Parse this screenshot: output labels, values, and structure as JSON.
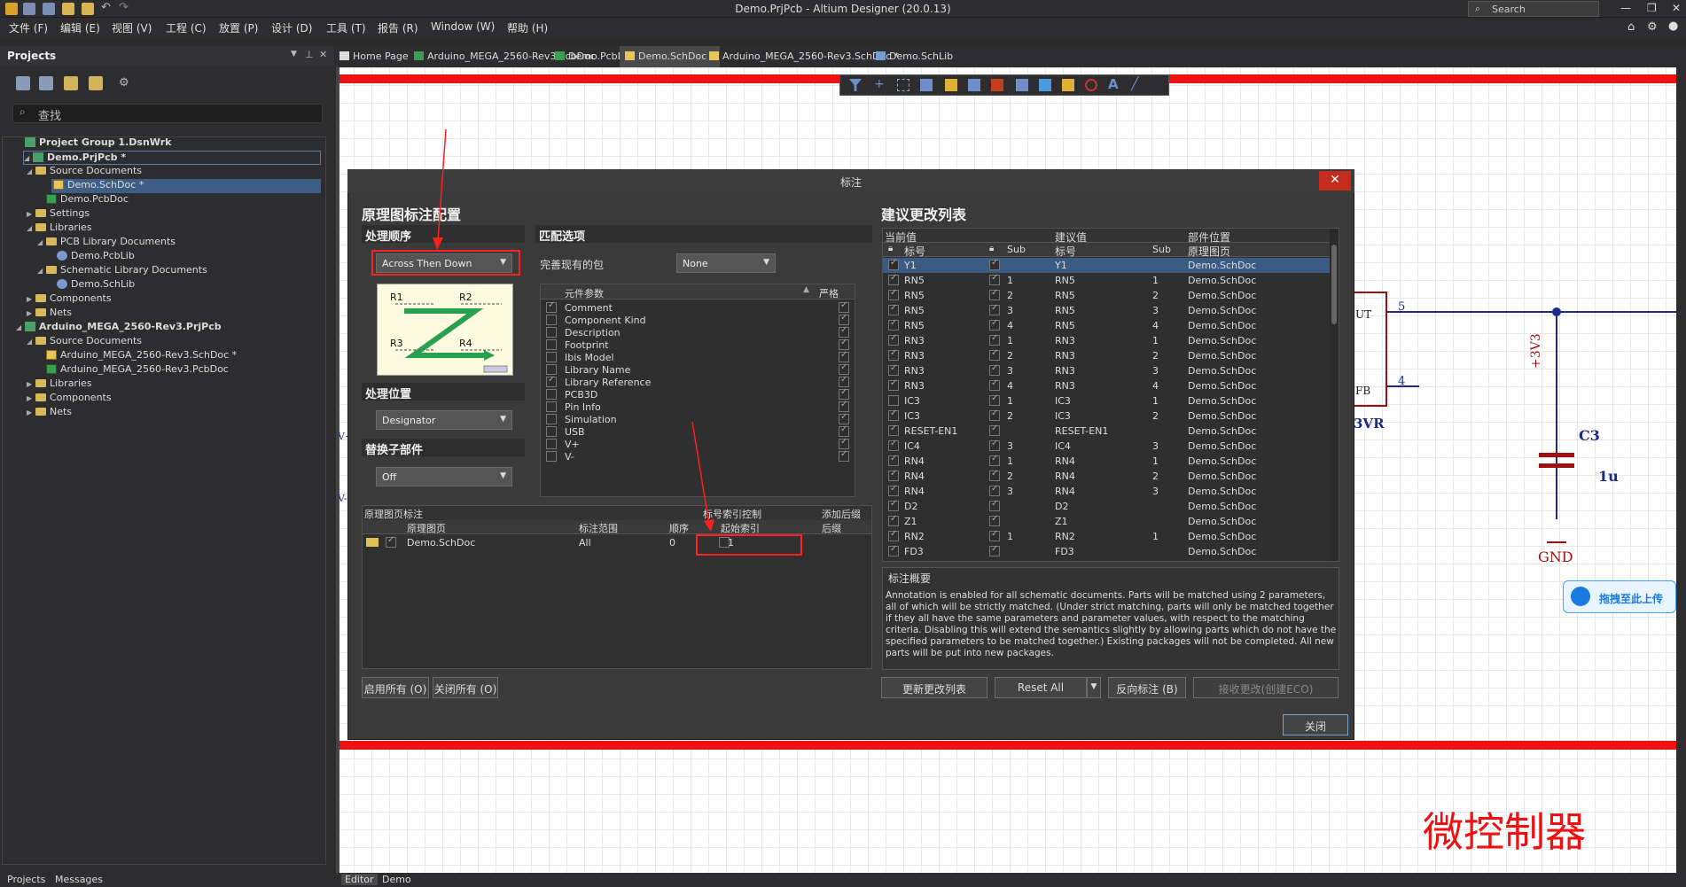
{
  "app": {
    "title": "Demo.PrjPcb - Altium Designer (20.0.13)",
    "search_placeholder": "Search"
  },
  "menu": [
    "文件 (F)",
    "编辑 (E)",
    "视图 (V)",
    "工程 (C)",
    "放置 (P)",
    "设计 (D)",
    "工具 (T)",
    "报告 (R)",
    "Window (W)",
    "帮助 (H)"
  ],
  "projects_panel": {
    "title": "Projects",
    "search_placeholder": "查找",
    "tree": [
      {
        "label": "Project Group 1.DsnWrk",
        "icon": "workspace",
        "depth": 0,
        "expand": ""
      },
      {
        "label": "Demo.PrjPcb *",
        "icon": "project",
        "depth": 0,
        "expand": "open",
        "selected_outline": true
      },
      {
        "label": "Source Documents",
        "icon": "folder",
        "depth": 1,
        "expand": "open"
      },
      {
        "label": "Demo.SchDoc *",
        "icon": "sch",
        "depth": 2,
        "expand": "",
        "selected": true
      },
      {
        "label": "Demo.PcbDoc",
        "icon": "pcb",
        "depth": 2,
        "expand": ""
      },
      {
        "label": "Settings",
        "icon": "folder",
        "depth": 1,
        "expand": "closed"
      },
      {
        "label": "Libraries",
        "icon": "folder",
        "depth": 1,
        "expand": "open"
      },
      {
        "label": "PCB Library Documents",
        "icon": "folder",
        "depth": 2,
        "expand": "open"
      },
      {
        "label": "Demo.PcbLib",
        "icon": "lib",
        "depth": 3,
        "expand": ""
      },
      {
        "label": "Schematic Library Documents",
        "icon": "folder",
        "depth": 2,
        "expand": "open"
      },
      {
        "label": "Demo.SchLib",
        "icon": "lib",
        "depth": 3,
        "expand": ""
      },
      {
        "label": "Components",
        "icon": "folder",
        "depth": 1,
        "expand": "closed"
      },
      {
        "label": "Nets",
        "icon": "folder",
        "depth": 1,
        "expand": "closed"
      },
      {
        "label": "Arduino_MEGA_2560-Rev3.PrjPcb",
        "icon": "project",
        "depth": 0,
        "expand": "open"
      },
      {
        "label": "Source Documents",
        "icon": "folder",
        "depth": 1,
        "expand": "open"
      },
      {
        "label": "Arduino_MEGA_2560-Rev3.SchDoc *",
        "icon": "sch",
        "depth": 2,
        "expand": ""
      },
      {
        "label": "Arduino_MEGA_2560-Rev3.PcbDoc",
        "icon": "pcb",
        "depth": 2,
        "expand": ""
      },
      {
        "label": "Libraries",
        "icon": "folder",
        "depth": 1,
        "expand": "closed"
      },
      {
        "label": "Components",
        "icon": "folder",
        "depth": 1,
        "expand": "closed"
      },
      {
        "label": "Nets",
        "icon": "folder",
        "depth": 1,
        "expand": "closed"
      }
    ],
    "bottom_tabs": [
      "Projects",
      "Messages"
    ]
  },
  "doc_tabs": [
    {
      "label": "Home Page",
      "icon": "home"
    },
    {
      "label": "Arduino_MEGA_2560-Rev3.PcbDoc",
      "icon": "pcb"
    },
    {
      "label": "Demo.PcbDoc",
      "icon": "pcb"
    },
    {
      "label": "Demo.SchDoc *",
      "icon": "sch",
      "active": true
    },
    {
      "label": "Arduino_MEGA_2560-Rev3.SchDoc *",
      "icon": "sch"
    },
    {
      "label": "Demo.SchLib",
      "icon": "lib"
    }
  ],
  "editor_tabs": [
    "Editor",
    "Demo"
  ],
  "dialog": {
    "title": "标注",
    "config_title": "原理图标注配置",
    "order_section": "处理顺序",
    "order_value": "Across Then Down",
    "matching_section": "匹配选项",
    "complete_packages_label": "完善现有的包",
    "complete_packages_value": "None",
    "param_header": "元件参数",
    "strict_header": "严格",
    "params": [
      {
        "name": "Comment",
        "checked": true
      },
      {
        "name": "Component Kind",
        "checked": false
      },
      {
        "name": "Description",
        "checked": false
      },
      {
        "name": "Footprint",
        "checked": false
      },
      {
        "name": "Ibis Model",
        "checked": false
      },
      {
        "name": "Library Name",
        "checked": false
      },
      {
        "name": "Library Reference",
        "checked": true
      },
      {
        "name": "PCB3D",
        "checked": false
      },
      {
        "name": "Pin Info",
        "checked": false
      },
      {
        "name": "Simulation",
        "checked": false
      },
      {
        "name": "USB",
        "checked": false
      },
      {
        "name": "V+",
        "checked": false
      },
      {
        "name": "V-",
        "checked": false
      }
    ],
    "location_section": "处理位置",
    "location_value": "Designator",
    "replace_section": "替换子部件",
    "replace_value": "Off",
    "sheet_section": "原理图页标注",
    "index_control": "标号索引控制",
    "add_suffix": "添加后缀",
    "sheet_cols": [
      "原理图页",
      "标注范围",
      "顺序",
      "起始索引",
      "后缀"
    ],
    "sheet_rows": [
      {
        "sheet": "Demo.SchDoc",
        "scope": "All",
        "order": "0",
        "start_index": "1",
        "suffix": ""
      }
    ],
    "enable_all": "启用所有 (O)",
    "disable_all": "关闭所有 (O)",
    "changes_title": "建议更改列表",
    "current_group": "当前值",
    "proposed_group": "建议值",
    "location_group": "部件位置",
    "col_designator": "标号",
    "col_sub": "Sub",
    "col_new_designator": "标号",
    "col_new_sub": "Sub",
    "col_sheet": "原理图页",
    "changes": [
      {
        "cur": "Y1",
        "cur_sub": "",
        "new": "Y1",
        "new_sub": "",
        "sheet": "Demo.SchDoc",
        "lock1": true,
        "lock2": true,
        "selected": true
      },
      {
        "cur": "RN5",
        "cur_sub": "1",
        "new": "RN5",
        "new_sub": "1",
        "sheet": "Demo.SchDoc",
        "lock1": true,
        "lock2": true
      },
      {
        "cur": "RN5",
        "cur_sub": "2",
        "new": "RN5",
        "new_sub": "2",
        "sheet": "Demo.SchDoc",
        "lock1": true,
        "lock2": true
      },
      {
        "cur": "RN5",
        "cur_sub": "3",
        "new": "RN5",
        "new_sub": "3",
        "sheet": "Demo.SchDoc",
        "lock1": true,
        "lock2": true
      },
      {
        "cur": "RN5",
        "cur_sub": "4",
        "new": "RN5",
        "new_sub": "4",
        "sheet": "Demo.SchDoc",
        "lock1": true,
        "lock2": true
      },
      {
        "cur": "RN3",
        "cur_sub": "1",
        "new": "RN3",
        "new_sub": "1",
        "sheet": "Demo.SchDoc",
        "lock1": true,
        "lock2": true
      },
      {
        "cur": "RN3",
        "cur_sub": "2",
        "new": "RN3",
        "new_sub": "2",
        "sheet": "Demo.SchDoc",
        "lock1": true,
        "lock2": true
      },
      {
        "cur": "RN3",
        "cur_sub": "3",
        "new": "RN3",
        "new_sub": "3",
        "sheet": "Demo.SchDoc",
        "lock1": true,
        "lock2": true
      },
      {
        "cur": "RN3",
        "cur_sub": "4",
        "new": "RN3",
        "new_sub": "4",
        "sheet": "Demo.SchDoc",
        "lock1": true,
        "lock2": true
      },
      {
        "cur": "IC3",
        "cur_sub": "1",
        "new": "IC3",
        "new_sub": "1",
        "sheet": "Demo.SchDoc",
        "lock1": false,
        "lock2": true
      },
      {
        "cur": "IC3",
        "cur_sub": "2",
        "new": "IC3",
        "new_sub": "2",
        "sheet": "Demo.SchDoc",
        "lock1": true,
        "lock2": true
      },
      {
        "cur": "RESET-EN1",
        "cur_sub": "",
        "new": "RESET-EN1",
        "new_sub": "",
        "sheet": "Demo.SchDoc",
        "lock1": true,
        "lock2": true
      },
      {
        "cur": "IC4",
        "cur_sub": "3",
        "new": "IC4",
        "new_sub": "3",
        "sheet": "Demo.SchDoc",
        "lock1": true,
        "lock2": true
      },
      {
        "cur": "RN4",
        "cur_sub": "1",
        "new": "RN4",
        "new_sub": "1",
        "sheet": "Demo.SchDoc",
        "lock1": true,
        "lock2": true
      },
      {
        "cur": "RN4",
        "cur_sub": "2",
        "new": "RN4",
        "new_sub": "2",
        "sheet": "Demo.SchDoc",
        "lock1": true,
        "lock2": true
      },
      {
        "cur": "RN4",
        "cur_sub": "3",
        "new": "RN4",
        "new_sub": "3",
        "sheet": "Demo.SchDoc",
        "lock1": true,
        "lock2": true
      },
      {
        "cur": "D2",
        "cur_sub": "",
        "new": "D2",
        "new_sub": "",
        "sheet": "Demo.SchDoc",
        "lock1": true,
        "lock2": true
      },
      {
        "cur": "Z1",
        "cur_sub": "",
        "new": "Z1",
        "new_sub": "",
        "sheet": "Demo.SchDoc",
        "lock1": true,
        "lock2": true
      },
      {
        "cur": "RN2",
        "cur_sub": "1",
        "new": "RN2",
        "new_sub": "1",
        "sheet": "Demo.SchDoc",
        "lock1": true,
        "lock2": true
      },
      {
        "cur": "FD3",
        "cur_sub": "",
        "new": "FD3",
        "new_sub": "",
        "sheet": "Demo.SchDoc",
        "lock1": true,
        "lock2": true
      }
    ],
    "summary_title": "标注概要",
    "summary_text": "Annotation is enabled for all schematic documents. Parts will be matched using 2 parameters, all of which will be strictly matched. (Under strict matching, parts will only be matched together if they all have the same parameters and parameter values, with respect to the matching criteria. Disabling this will extend the semantics slightly by allowing parts which do not have the specified parameters to be matched together.) Existing packages will not be completed. All new parts will be put into new packages.",
    "update_btn": "更新更改列表",
    "reset_btn": "Reset All",
    "back_annotate_btn": "反向标注 (B)",
    "accept_btn": "接收更改(创建ECO)",
    "close_btn": "关闭"
  },
  "preview": {
    "labels": [
      "R1",
      "R2",
      "R3",
      "R4"
    ]
  },
  "schematic": {
    "pin5": "5",
    "pin4": "4",
    "pin_ut": "UT",
    "pin_fb": "FB",
    "part_suffix": "3VR",
    "rail": "+3V3",
    "cap_name": "C3",
    "cap_value": "1u",
    "gnd": "GND",
    "title_cn": "微控制器"
  },
  "upload_overlay": "拖拽至此上传",
  "colors": {
    "accent_selection": "#3b5b84",
    "schematic_red": "#ee1111",
    "net_blue": "#1a2b8a",
    "component_red": "#a01010",
    "close_red": "#c42b1c"
  }
}
